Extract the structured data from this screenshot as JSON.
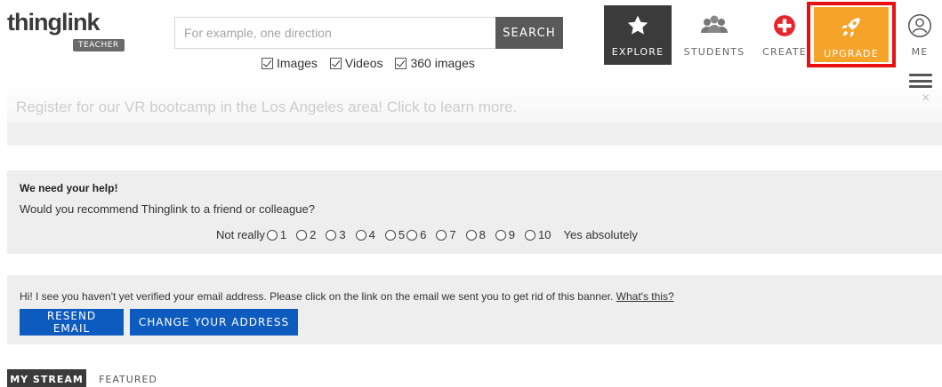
{
  "header": {
    "logo_text": "thinglink",
    "logo_badge": "TEACHER",
    "search_placeholder": "For example, one direction",
    "search_button": "SEARCH",
    "filters": [
      {
        "label": "Images",
        "checked": true
      },
      {
        "label": "Videos",
        "checked": true
      },
      {
        "label": "360 images",
        "checked": true
      }
    ],
    "nav": {
      "explore": "EXPLORE",
      "students": "STUDENTS",
      "create": "CREATE",
      "upgrade": "UPGRADE",
      "me": "ME"
    }
  },
  "promo": {
    "text": "Register for our VR bootcamp in the Los Angeles area! Click to learn more.",
    "close": "×"
  },
  "survey": {
    "title": "We need your help!",
    "question": "Would you recommend Thinglink to a friend or colleague?",
    "left_label": "Not really",
    "right_label": "Yes absolutely",
    "options": [
      "1",
      "2",
      "3",
      "4",
      "5",
      "6",
      "7",
      "8",
      "9",
      "10"
    ]
  },
  "verify": {
    "text": "Hi! I see you haven't yet verified your email address. Please click on the link on the email we sent you to get rid of this banner.",
    "link": "What's this?",
    "resend_button": "RESEND EMAIL",
    "change_button": "CHANGE YOUR ADDRESS"
  },
  "tabs": {
    "my_stream": "MY STREAM",
    "featured": "FEATURED"
  },
  "colors": {
    "upgrade": "#f6a32a",
    "highlight_border": "#e81010",
    "button_blue": "#0e5bbf",
    "dark_nav": "#3b3b3b"
  }
}
